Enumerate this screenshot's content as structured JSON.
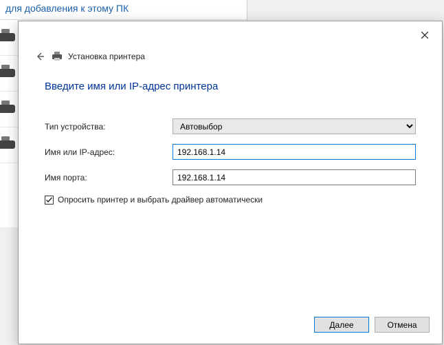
{
  "backdrop": {
    "title_fragment": "для добавления к этому ПК"
  },
  "dialog": {
    "wizard_title": "Установка принтера",
    "instruction": "Введите имя или IP-адрес принтера",
    "fields": {
      "device_type_label": "Тип устройства:",
      "device_type_value": "Автовыбор",
      "hostname_label": "Имя или IP-адрес:",
      "hostname_value": "192.168.1.14",
      "port_label": "Имя порта:",
      "port_value": "192.168.1.14"
    },
    "checkbox": {
      "label": "Опросить принтер и выбрать драйвер автоматически",
      "checked": true
    },
    "buttons": {
      "next": "Далее",
      "cancel": "Отмена"
    }
  }
}
